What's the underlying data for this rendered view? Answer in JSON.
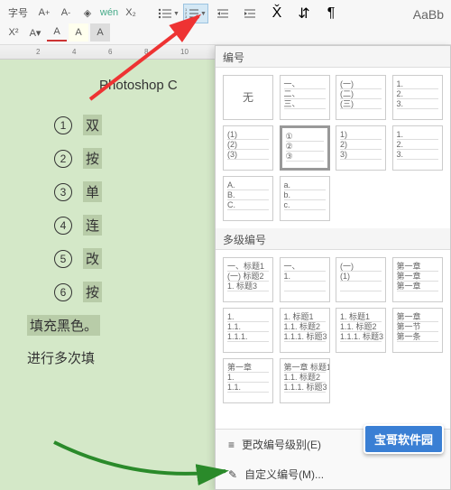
{
  "toolbar": {
    "font_label": "字号",
    "style_preview": "AaBb"
  },
  "document": {
    "title": "Photoshop C",
    "items": [
      {
        "num": "1",
        "char": "双"
      },
      {
        "num": "2",
        "char": "按"
      },
      {
        "num": "3",
        "char": "单"
      },
      {
        "num": "4",
        "char": "连"
      },
      {
        "num": "5",
        "char": "改"
      },
      {
        "num": "6",
        "char": "按"
      }
    ],
    "line7": "填充黑色。",
    "line8": "进行多次填"
  },
  "panel": {
    "header_numbering": "编号",
    "header_multilevel": "多级编号",
    "none_label": "无",
    "presets_row1": [
      {
        "lines": [
          "一、",
          "二、",
          "三、"
        ]
      },
      {
        "lines": [
          "(一)",
          "(二)",
          "(三)"
        ]
      },
      {
        "lines": [
          "1.",
          "2.",
          "3."
        ]
      }
    ],
    "presets_row2": [
      {
        "lines": [
          "(1)",
          "(2)",
          "(3)"
        ]
      },
      {
        "lines": [
          "①",
          "②",
          "③"
        ],
        "selected": true
      },
      {
        "lines": [
          "1)",
          "2)",
          "3)"
        ]
      },
      {
        "lines": [
          "1.",
          "2.",
          "3."
        ]
      }
    ],
    "presets_row3": [
      {
        "lines": [
          "A.",
          "B.",
          "C."
        ]
      },
      {
        "lines": [
          "a.",
          "b.",
          "c."
        ]
      }
    ],
    "ml_row1": [
      {
        "lines": [
          "一、标题1",
          "(一) 标题2",
          "1. 标题3"
        ]
      },
      {
        "lines": [
          "一、",
          "1.",
          ""
        ]
      },
      {
        "lines": [
          "(一)",
          "(1)",
          ""
        ]
      },
      {
        "lines": [
          "第一章",
          "第一章",
          "第一章"
        ]
      }
    ],
    "ml_row2": [
      {
        "lines": [
          "1.",
          "1.1.",
          "1.1.1."
        ]
      },
      {
        "lines": [
          "1. 标题1",
          "1.1. 标题2",
          "1.1.1. 标题3"
        ]
      },
      {
        "lines": [
          "1. 标题1",
          "1.1. 标题2",
          "1.1.1. 标题3"
        ]
      },
      {
        "lines": [
          "第一章",
          "第一节",
          "第一条"
        ]
      }
    ],
    "ml_row3": [
      {
        "lines": [
          "第一章",
          "1.",
          "1.1."
        ]
      },
      {
        "lines": [
          "第一章 标题1",
          "1.1. 标题2",
          "1.1.1. 标题3"
        ]
      }
    ],
    "footer_change_level": "更改编号级别(E)",
    "footer_custom": "自定义编号(M)..."
  },
  "watermark": "宝哥软件园"
}
